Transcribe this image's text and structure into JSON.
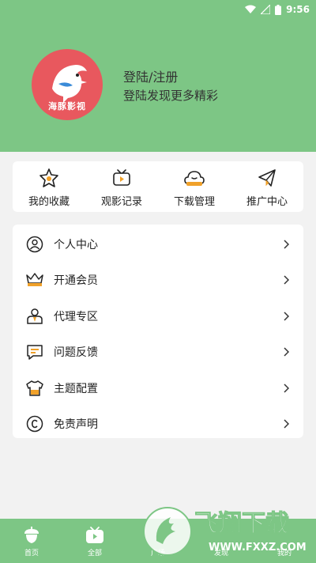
{
  "status_bar": {
    "time": "9:56"
  },
  "profile": {
    "logo_text": "海豚影视",
    "login_title": "登陆/注册",
    "login_subtitle": "登陆发现更多精彩"
  },
  "quick_actions": [
    {
      "label": "我的收藏",
      "icon": "star-icon"
    },
    {
      "label": "观影记录",
      "icon": "tv-play-icon"
    },
    {
      "label": "下载管理",
      "icon": "download-cloud-icon"
    },
    {
      "label": "推广中心",
      "icon": "paper-plane-icon"
    }
  ],
  "menu": [
    {
      "label": "个人中心",
      "icon": "person-icon"
    },
    {
      "label": "开通会员",
      "icon": "crown-icon"
    },
    {
      "label": "代理专区",
      "icon": "agent-icon"
    },
    {
      "label": "问题反馈",
      "icon": "feedback-icon"
    },
    {
      "label": "主题配置",
      "icon": "shirt-icon"
    },
    {
      "label": "免责声明",
      "icon": "copyright-icon"
    }
  ],
  "tabbar": [
    {
      "label": "首页",
      "icon": "home-acorn-icon"
    },
    {
      "label": "全部",
      "icon": "tv-icon"
    },
    {
      "label": "广场",
      "icon": ""
    },
    {
      "label": "发现",
      "icon": ""
    },
    {
      "label": "我的",
      "icon": ""
    }
  ],
  "watermark": {
    "brand": "飞翔下载",
    "url": "WWW.FXXZ.COM"
  },
  "colors": {
    "accent_green": "#7dc685",
    "icon_orange": "#f0a12a"
  }
}
